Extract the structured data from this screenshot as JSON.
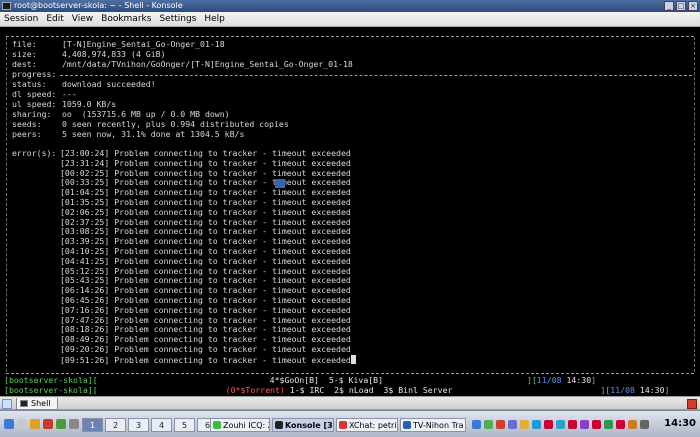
{
  "window": {
    "title": "root@bootserver-skola: ~ - Shell - Konsole",
    "buttons": [
      "_",
      "□",
      "×"
    ]
  },
  "menu": [
    "Session",
    "Edit",
    "View",
    "Bookmarks",
    "Settings",
    "Help"
  ],
  "torrent": {
    "fields": [
      {
        "label": "file:",
        "value": "[T-N]Engine_Sentai_Go-Onger_01-18"
      },
      {
        "label": "size:",
        "value": "4,408,974,833 (4 GiB)"
      },
      {
        "label": "dest:",
        "value": "/mnt/data/TVnihon/GoOnger/[T-N]Engine_Sentai_Go-Onger_01-18"
      },
      {
        "label": "progress:",
        "value": ""
      },
      {
        "label": "status:",
        "value": "download succeeded!"
      },
      {
        "label": "dl speed:",
        "value": "---"
      },
      {
        "label": "ul speed:",
        "value": "1059.0 KB/s"
      },
      {
        "label": "sharing:",
        "value": "oo  (153715.6 MB up / 0.0 MB down)"
      },
      {
        "label": "seeds:",
        "value": "0 seen recently, plus 0.994 distributed copies"
      },
      {
        "label": "peers:",
        "value": "5 seen now, 31.1% done at 1304.5 kB/s"
      }
    ],
    "errors_label": "error(s):",
    "errors": [
      "[23:00:24] Problem connecting to tracker - timeout exceeded",
      "[23:31:24] Problem connecting to tracker - timeout exceeded",
      "[00:02:25] Problem connecting to tracker - timeout exceeded",
      "[00:33:25] Problem connecting to tracker - timeout exceeded",
      "[01:04:25] Problem connecting to tracker - timeout exceeded",
      "[01:35:25] Problem connecting to tracker - timeout exceeded",
      "[02:06:25] Problem connecting to tracker - timeout exceeded",
      "[02:37:25] Problem connecting to tracker - timeout exceeded",
      "[03:08:25] Problem connecting to tracker - timeout exceeded",
      "[03:39:25] Problem connecting to tracker - timeout exceeded",
      "[04:10:25] Problem connecting to tracker - timeout exceeded",
      "[04:41:25] Problem connecting to tracker - timeout exceeded",
      "[05:12:25] Problem connecting to tracker - timeout exceeded",
      "[05:43:25] Problem connecting to tracker - timeout exceeded",
      "[06:14:26] Problem connecting to tracker - timeout exceeded",
      "[06:45:26] Problem connecting to tracker - timeout exceeded",
      "[07:16:26] Problem connecting to tracker - timeout exceeded",
      "[07:47:26] Problem connecting to tracker - timeout exceeded",
      "[08:18:26] Problem connecting to tracker - timeout exceeded",
      "[08:49:26] Problem connecting to tracker - timeout exceeded",
      "[09:20:26] Problem connecting to tracker - timeout exceeded",
      "[09:51:26] Problem connecting to tracker - timeout exceeded"
    ]
  },
  "screen_status": {
    "line1": {
      "left_open": "[",
      "host": "bootserver-skola",
      "left_close": "][",
      "windows": "4*$GoOn[B]  5-$ Kiva[B]",
      "right_open": "][",
      "date": "11/08",
      "time": "14:30",
      "right_close": "]"
    },
    "line2": {
      "left_open": "[",
      "host": "bootserver-skola",
      "left_close": "][",
      "active_window": "(0*$Torrent)",
      "windows": "1-$ IRC  2$ nLoad  3$ Binl Server",
      "right_open": "][",
      "date": "11/08",
      "time": "14:30",
      "right_close": "]"
    }
  },
  "tabs": [
    {
      "label": "Shell"
    }
  ],
  "taskbar": {
    "desktops": [
      "1",
      "2",
      "3",
      "4",
      "5",
      "6"
    ],
    "tasks": [
      {
        "label": "Zouhi ICQ: Z"
      },
      {
        "label": "Konsole [3]"
      },
      {
        "label": "XChat: petrik"
      },
      {
        "label": "TV-Nihon Tra"
      }
    ],
    "clock": "14:30"
  },
  "colors": {
    "screen_green": "#5cd35c",
    "screen_red": "#ff5a4a",
    "screen_blue": "#5a8ff0",
    "terminal_bg": "#000000",
    "terminal_fg": "#d8d8d8"
  }
}
